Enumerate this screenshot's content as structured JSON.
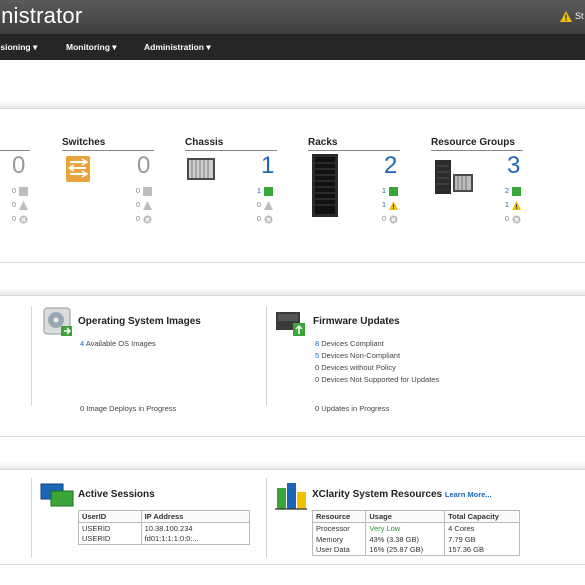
{
  "header": {
    "title": "inistrator",
    "user_truncated": "St"
  },
  "nav": [
    "isioning ▾",
    "Monitoring ▾",
    "Administration ▾"
  ],
  "hardware": {
    "cut_count": "0",
    "cut_rows": [
      "0",
      "0",
      "0"
    ],
    "items": [
      {
        "name": "Switches",
        "count": "0",
        "rows": [
          "0",
          "0",
          "0"
        ]
      },
      {
        "name": "Chassis",
        "count": "1",
        "rows": [
          "1",
          "0",
          "0"
        ]
      },
      {
        "name": "Racks",
        "count": "2",
        "rows": [
          "1",
          "1",
          "0"
        ]
      },
      {
        "name": "Resource Groups",
        "count": "3",
        "rows": [
          "2",
          "1",
          "0"
        ]
      }
    ]
  },
  "provisioning": {
    "os_images": {
      "title": "Operating System Images",
      "available_count": "4",
      "available_label": "Available OS Images",
      "deploys": "0 Image Deploys in Progress"
    },
    "firmware": {
      "title": "Firmware Updates",
      "compliant_count": "8",
      "compliant_label": "Devices Compliant",
      "noncompliant_count": "5",
      "noncompliant_label": "Devices Non-Compliant",
      "without_policy": "0 Devices without Policy",
      "not_supported": "0 Devices Not Supported for Updates",
      "in_progress": "0 Updates in Progress"
    }
  },
  "sessions": {
    "title": "Active Sessions",
    "headers": [
      "UserID",
      "IP Address"
    ],
    "rows": [
      [
        "USERID",
        "10.38.100.234"
      ],
      [
        "USERID",
        "fd01:1:1:1:0:0:..."
      ]
    ]
  },
  "resources": {
    "title": "XClarity System Resources",
    "learn_more": "Learn More...",
    "headers": [
      "Resource",
      "Usage",
      "Total Capacity"
    ],
    "rows": [
      [
        "Processor",
        "Very Low",
        "4 Cores"
      ],
      [
        "Memory",
        "43% (3.38 GB)",
        "7.79 GB"
      ],
      [
        "User Data",
        "16% (25.87 GB)",
        "157.36 GB"
      ]
    ]
  },
  "colors": {
    "accent": "#1b66b8",
    "ok": "#3aa63a",
    "warning": "#f2c200",
    "nav": "#262626"
  }
}
